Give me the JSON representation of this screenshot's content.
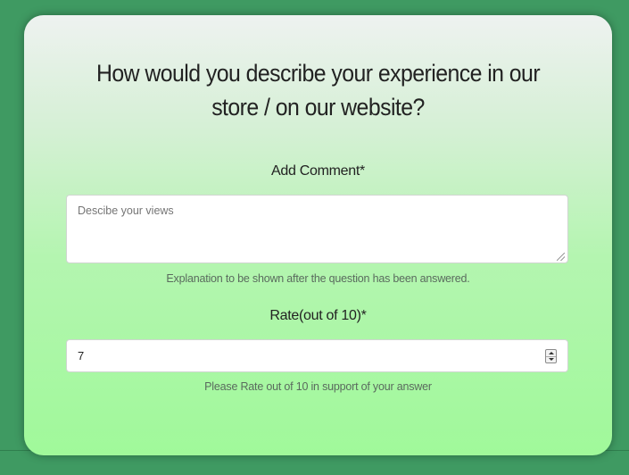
{
  "form": {
    "title": "How would you describe your experience in our store / on our website?",
    "comment": {
      "label": "Add Comment",
      "required_mark": "*",
      "placeholder": "Descibe your views",
      "value": "",
      "helper": "Explanation to be shown after the question has been answered."
    },
    "rating": {
      "label": "Rate(out of 10)",
      "required_mark": "*",
      "value": "7",
      "helper": "Please Rate out of 10 in support of your answer"
    }
  },
  "colors": {
    "page_background": "#3f9a62",
    "card_top": "#eef2f0",
    "card_bottom": "#a0f99a"
  },
  "icons": {
    "resize": "resize-grip-icon",
    "spinner_up": "chevron-up-icon",
    "spinner_down": "chevron-down-icon"
  }
}
